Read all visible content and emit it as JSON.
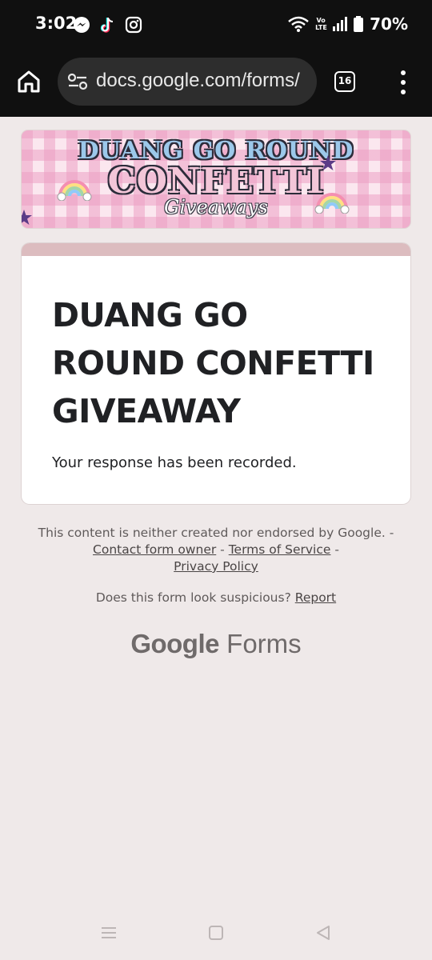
{
  "status_bar": {
    "time": "3:02",
    "battery_percent": "70%",
    "network_label": "Vo LTE",
    "apps": [
      "messenger-icon",
      "tiktok-icon",
      "instagram-icon"
    ]
  },
  "browser": {
    "url": "docs.google.com/forms/",
    "tab_count": "16"
  },
  "banner": {
    "line1": "DUANG GO ROUND",
    "line2": "CONFETTI",
    "line3": "Giveaways"
  },
  "form": {
    "title": "DUANG GO ROUND CONFETTI GIVEAWAY",
    "confirmation": "Your response has been recorded."
  },
  "footer": {
    "disclaimer_text": "This content is neither created nor endorsed by Google. -",
    "contact_link": "Contact form owner",
    "separator1": "-",
    "terms_link": "Terms of Service",
    "separator2": "-",
    "privacy_link": "Privacy Policy",
    "suspicious_text": "Does this form look suspicious?",
    "report_link": "Report"
  },
  "logo": {
    "google": "Google",
    "forms": "Forms"
  },
  "colors": {
    "page_background": "#efe9e9",
    "card_accent": "#dcbcbf",
    "status_bar": "#101010",
    "url_bar": "#2d2d2d"
  }
}
